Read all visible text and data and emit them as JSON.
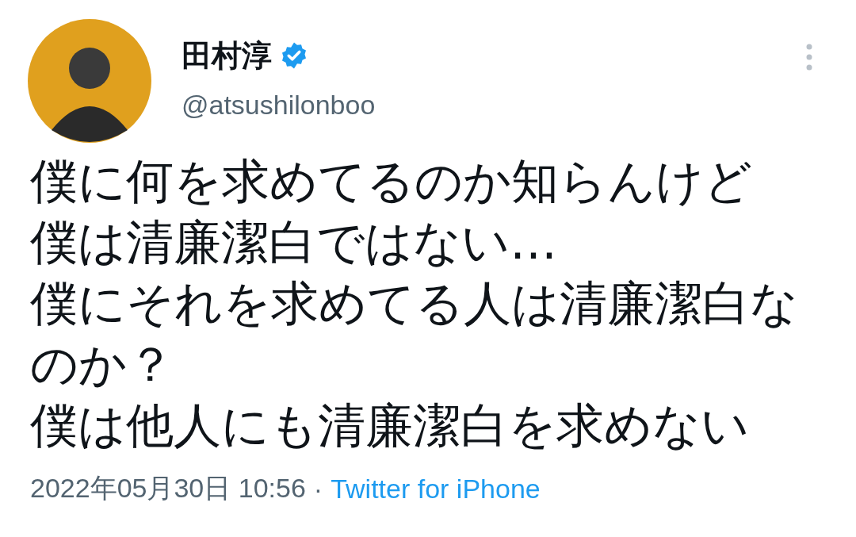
{
  "author": {
    "name": "田村淳",
    "verified": true,
    "handle": "@atsushilonboo"
  },
  "lines": [
    "僕に何を求めてるのか知らんけど",
    "僕は清廉潔白ではない…",
    "僕にそれを求めてる人は清廉潔白なのか？",
    "僕は他人にも清廉潔白を求めない"
  ],
  "timestamp": "2022年05月30日 10:56",
  "separator": "·",
  "source": "Twitter for iPhone"
}
